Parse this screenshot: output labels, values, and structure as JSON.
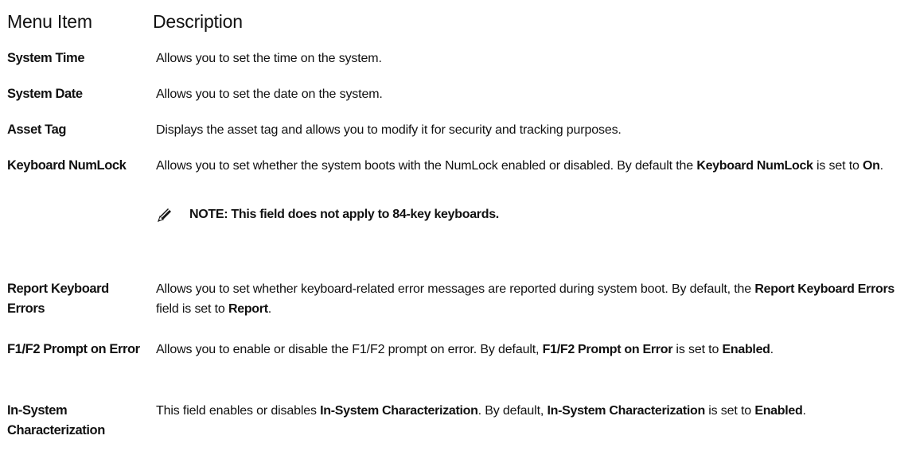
{
  "headers": {
    "menu_item": "Menu Item",
    "description": "Description"
  },
  "rows": [
    {
      "label": "System Time",
      "desc": [
        "Allows you to set the time on the system."
      ]
    },
    {
      "label": "System Date",
      "desc": [
        "Allows you to set the date on the system."
      ]
    },
    {
      "label": "Asset Tag",
      "desc": [
        "Displays the asset tag and allows you to modify it for security and tracking purposes."
      ]
    },
    {
      "label": "Keyboard NumLock",
      "desc": [
        "Allows you to set whether the system boots with the NumLock enabled or disabled. By default the ",
        "Keyboard NumLock",
        " is set to ",
        "On",
        "."
      ],
      "note": "NOTE: This field does not apply to 84-key keyboards."
    },
    {
      "label_lines": [
        "Report Keyboard",
        "Errors"
      ],
      "desc": [
        "Allows you to set whether keyboard-related error messages are reported during system boot. By default, the ",
        "Report Keyboard Errors",
        " field is set to ",
        "Report",
        "."
      ]
    },
    {
      "label": "F1/F2 Prompt on Error",
      "desc": [
        "Allows you to enable or disable the F1/F2 prompt on error. By default, ",
        "F1/F2 Prompt on Error",
        " is set to ",
        "Enabled",
        "."
      ]
    },
    {
      "label_lines": [
        "In-System",
        "Characterization"
      ],
      "desc": [
        "This field enables or disables ",
        "In-System Characterization",
        ". By default, ",
        "In-System Characterization",
        " is set to ",
        "Enabled",
        "."
      ]
    }
  ],
  "icons": {
    "note": "pencil-note-icon"
  }
}
